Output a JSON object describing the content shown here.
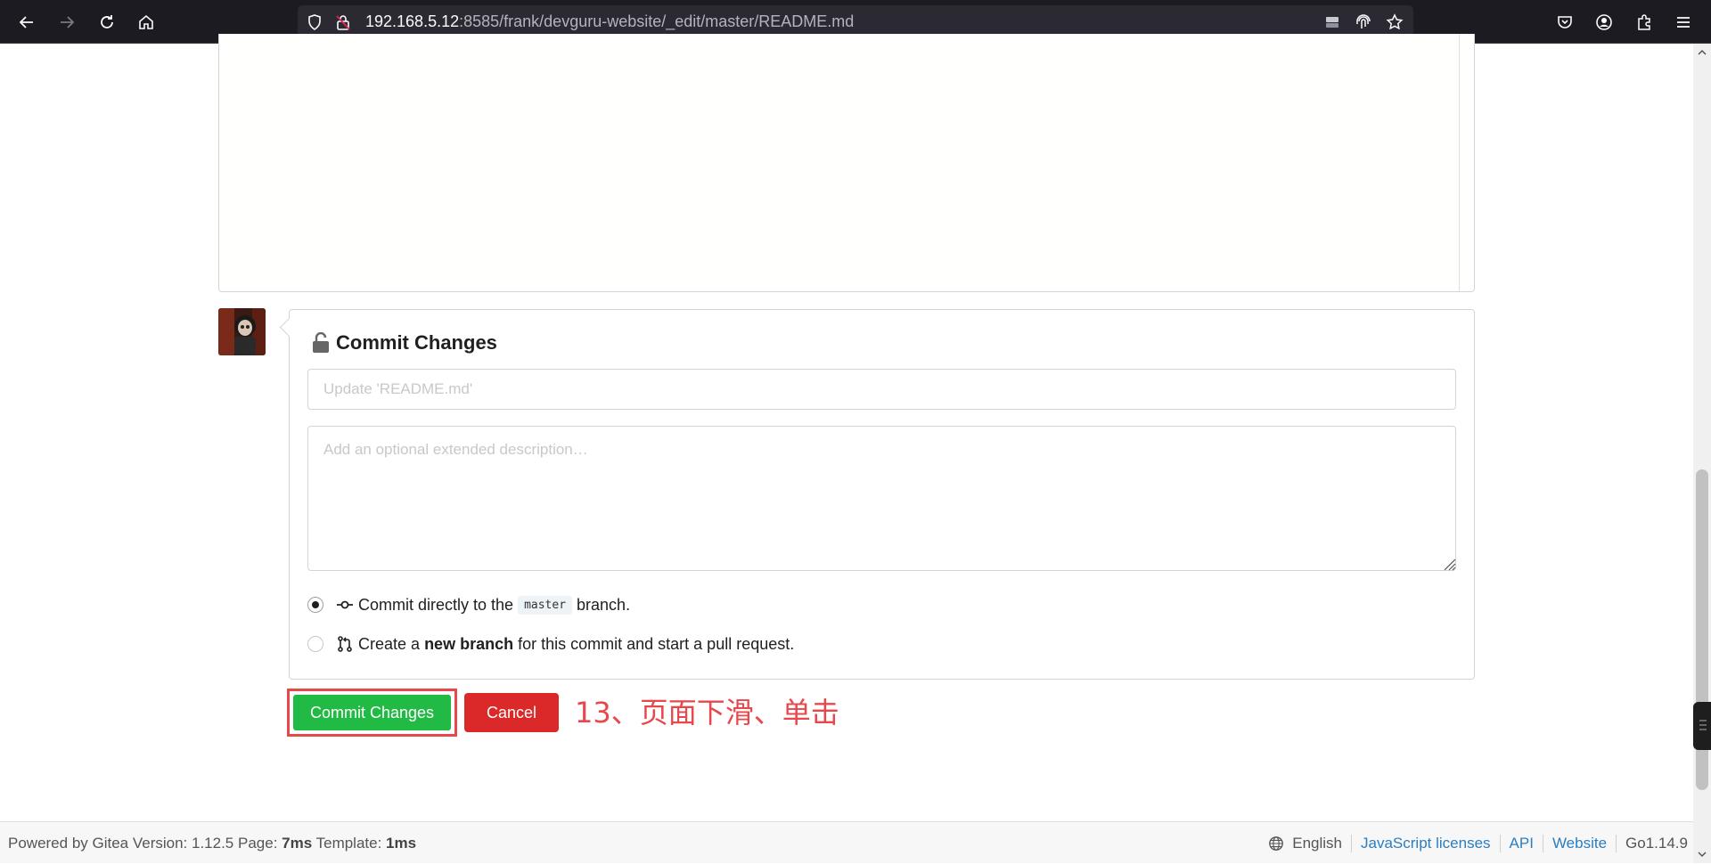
{
  "browser": {
    "url_host": "192.168.5.12",
    "url_rest": ":8585/frank/devguru-website/_edit/master/README.md"
  },
  "commit": {
    "title": "Commit Changes",
    "summary_placeholder": "Update 'README.md'",
    "description_placeholder": "Add an optional extended description…",
    "option_direct_prefix": "Commit directly to the",
    "branch_name": "master",
    "option_direct_suffix": "branch.",
    "option_new_prefix": "Create a",
    "option_new_bold": "new branch",
    "option_new_suffix": "for this commit and start a pull request.",
    "selected_option": "direct"
  },
  "buttons": {
    "commit_label": "Commit Changes",
    "cancel_label": "Cancel"
  },
  "annotation": {
    "text": "13、页面下滑、单击",
    "color": "#e8474c"
  },
  "footer": {
    "powered_by": "Powered by Gitea Version: 1.12.5 Page:",
    "page_time": "7ms",
    "template_label": "Template:",
    "template_time": "1ms",
    "language": "English",
    "links": [
      "JavaScript licenses",
      "API",
      "Website"
    ],
    "go_version": "Go1.14.9"
  },
  "colors": {
    "commit_button": "#21ba45",
    "cancel_button": "#db2828",
    "link": "#2a7ec1"
  }
}
